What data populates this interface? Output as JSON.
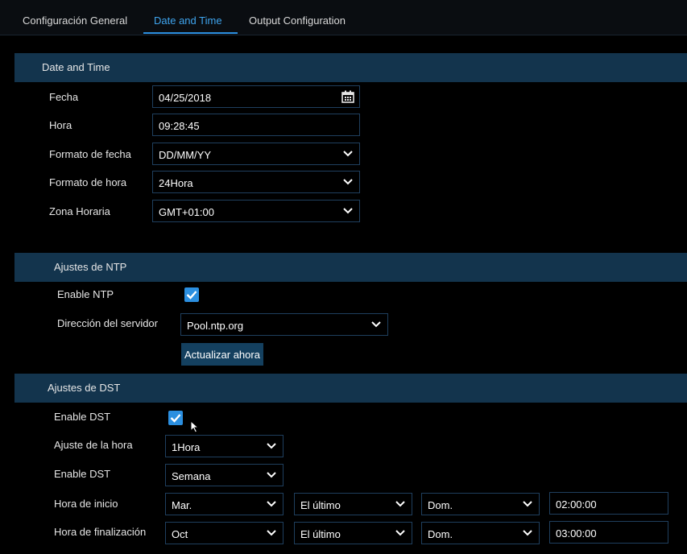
{
  "tabs": [
    {
      "label": "Configuración General"
    },
    {
      "label": "Date and Time"
    },
    {
      "label": "Output Configuration"
    }
  ],
  "date_time": {
    "title": "Date and Time",
    "fecha": {
      "label": "Fecha",
      "value": "04/25/2018"
    },
    "hora": {
      "label": "Hora",
      "value": "09:28:45"
    },
    "formato_fecha": {
      "label": "Formato de fecha",
      "value": "DD/MM/YY"
    },
    "formato_hora": {
      "label": "Formato de hora",
      "value": "24Hora"
    },
    "zona_horaria": {
      "label": "Zona Horaria",
      "value": "GMT+01:00"
    }
  },
  "ntp": {
    "title": "Ajustes de NTP",
    "enable_label": "Enable NTP",
    "enabled": true,
    "server_label": "Dirección del servidor",
    "server_value": "Pool.ntp.org",
    "update_button": "Actualizar ahora"
  },
  "dst": {
    "title": "Ajustes de DST",
    "enable_label": "Enable DST",
    "enabled": true,
    "offset_label": "Ajuste de la hora",
    "offset_value": "1Hora",
    "mode_label": "Enable DST",
    "mode_value": "Semana",
    "start": {
      "label": "Hora de inicio",
      "month": "Mar.",
      "week": "El último",
      "day": "Dom.",
      "time": "02:00:00"
    },
    "end": {
      "label": "Hora de finalización",
      "month": "Oct",
      "week": "El último",
      "day": "Dom.",
      "time": "03:00:00"
    }
  },
  "colors": {
    "accent": "#2b8fe0",
    "section_header": "#13344d",
    "field_border": "#1f3f5e"
  }
}
